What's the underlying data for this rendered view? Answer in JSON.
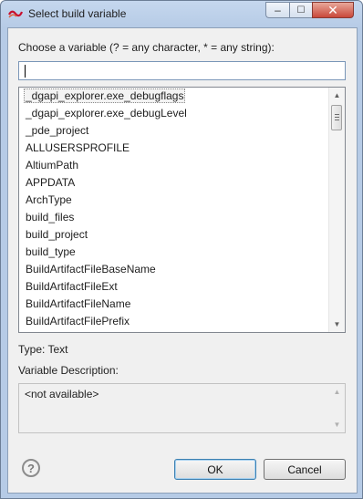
{
  "window": {
    "title": "Select build variable",
    "controls": {
      "minimize": "‒",
      "maximize": "☐",
      "close": "✕"
    }
  },
  "filter": {
    "label": "Choose a variable (? = any character, * = any string):",
    "value": ""
  },
  "variables": {
    "items": [
      "_dgapi_explorer.exe_debugflags",
      "_dgapi_explorer.exe_debugLevel",
      "_pde_project",
      "ALLUSERSPROFILE",
      "AltiumPath",
      "APPDATA",
      "ArchType",
      "build_files",
      "build_project",
      "build_type",
      "BuildArtifactFileBaseName",
      "BuildArtifactFileExt",
      "BuildArtifactFileName",
      "BuildArtifactFilePrefix"
    ],
    "selected_index": 0
  },
  "details": {
    "type_line": "Type: Text",
    "description_label": "Variable Description:",
    "description_text": "<not available>"
  },
  "buttons": {
    "help": "?",
    "ok": "OK",
    "cancel": "Cancel"
  },
  "icons": {
    "app": "eclipse-variable-icon",
    "help": "help-circle-icon",
    "scroll_up": "arrow-up-icon",
    "scroll_down": "arrow-down-icon"
  }
}
